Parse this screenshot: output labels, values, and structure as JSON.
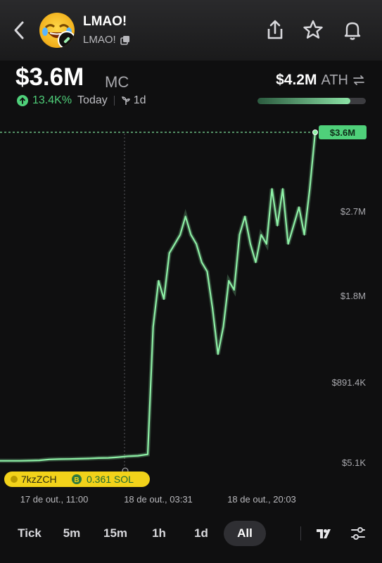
{
  "header": {
    "token_name": "LMAO!",
    "token_ticker": "LMAO!",
    "icons": [
      "back-arrow-icon",
      "copy-icon",
      "share-icon",
      "star-icon",
      "bell-icon"
    ]
  },
  "market": {
    "mc_value": "$3.6M",
    "mc_unit": "MC",
    "change_pct": "13.4K%",
    "change_period": "Today",
    "timeframe": "1d",
    "ath_value": "$4.2M",
    "ath_label": "ATH",
    "ath_progress": 0.86
  },
  "colors": {
    "accent_green": "#4fd07a",
    "line_green": "#8ef0a6",
    "marker_yellow": "#f2d21a"
  },
  "chart_data": {
    "type": "line",
    "y_ticks": [
      "$3.6M",
      "$2.7M",
      "$1.8M",
      "$891.4K",
      "$5.1K"
    ],
    "x_ticks": [
      "17 de out., 11:00",
      "18 de out., 03:31",
      "18 de out., 20:03"
    ],
    "current_price_label": "$3.6M",
    "ylim": [
      5.1,
      3600
    ],
    "series": [
      {
        "values": [
          40,
          40,
          40,
          42,
          45,
          55,
          58,
          60,
          62,
          65,
          70,
          72,
          80,
          90,
          95,
          110,
          1500,
          2000,
          1800,
          2300,
          2400,
          2500,
          2700,
          2500,
          2400,
          2200,
          2100,
          1700,
          1200,
          1500,
          2000,
          1900,
          2500,
          2700,
          2400,
          2200,
          2500,
          2400,
          3000,
          2600,
          3000,
          2400,
          2600,
          2800,
          2500,
          3000,
          3600
        ]
      }
    ],
    "trade_marker": {
      "wallet": "7kzZCH",
      "amount": "0.361 SOL"
    }
  },
  "timeframes": [
    "Tick",
    "5m",
    "15m",
    "1h",
    "1d",
    "All"
  ],
  "active_timeframe": "All"
}
